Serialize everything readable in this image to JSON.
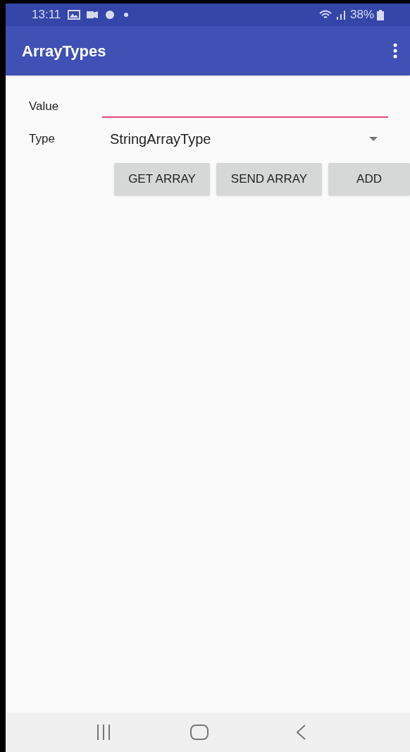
{
  "status_bar": {
    "time": "13:11",
    "battery": "38%"
  },
  "app_bar": {
    "title": "ArrayTypes"
  },
  "form": {
    "value_label": "Value",
    "value_field": {
      "focused": true
    },
    "type_label": "Type",
    "type_spinner": {
      "value": "StringArrayType"
    }
  },
  "buttons": [
    "GET ARRAY",
    "SEND ARRAY",
    "ADD"
  ]
}
